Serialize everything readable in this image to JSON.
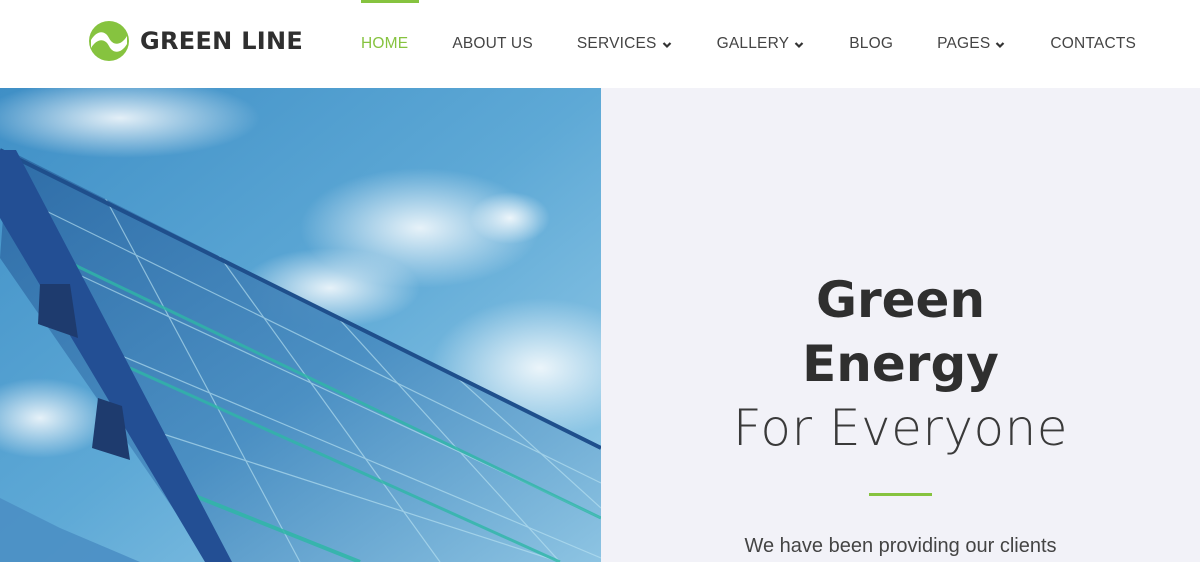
{
  "brand": {
    "name": "GREEN LINE",
    "colors": {
      "accent": "#86c33f",
      "text": "#2f2f2f",
      "panel": "#f2f2f8"
    }
  },
  "nav": {
    "items": [
      {
        "label": "HOME",
        "active": true,
        "dropdown": false
      },
      {
        "label": "ABOUT US",
        "active": false,
        "dropdown": false
      },
      {
        "label": "SERVICES",
        "active": false,
        "dropdown": true
      },
      {
        "label": "GALLERY",
        "active": false,
        "dropdown": true
      },
      {
        "label": "BLOG",
        "active": false,
        "dropdown": false
      },
      {
        "label": "PAGES",
        "active": false,
        "dropdown": true
      },
      {
        "label": "CONTACTS",
        "active": false,
        "dropdown": false
      }
    ]
  },
  "hero": {
    "title_line1": "Green",
    "title_line2": "Energy",
    "title_line3": "For Everyone",
    "subtitle": "We have been providing our clients",
    "image": "solar-panels-sky"
  }
}
